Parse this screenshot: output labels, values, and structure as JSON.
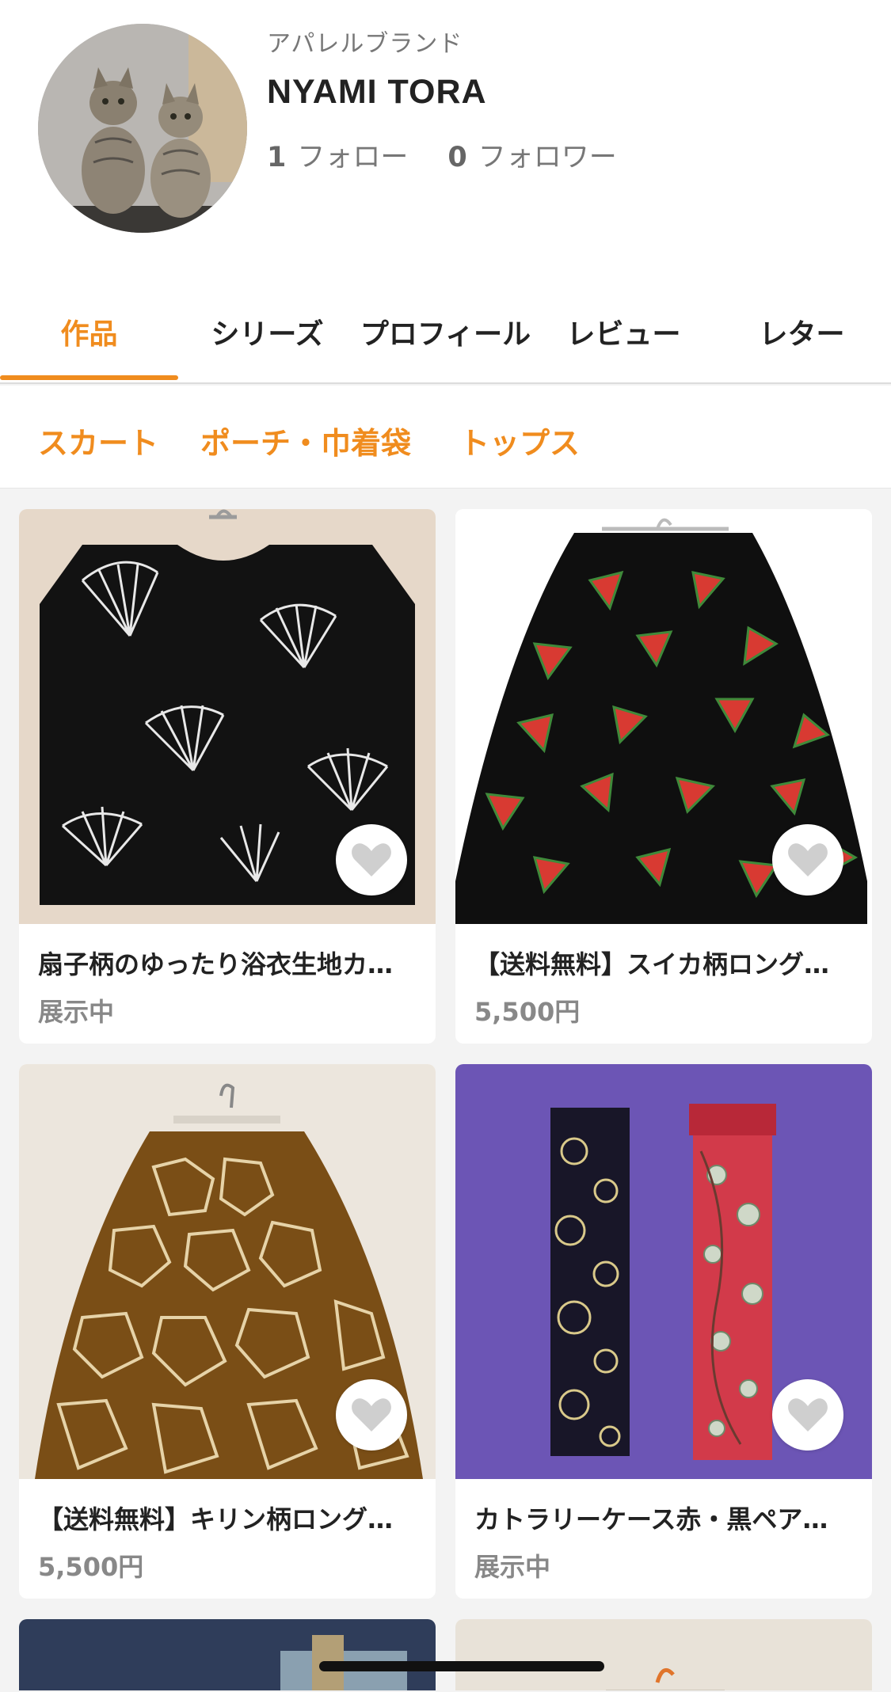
{
  "profile": {
    "category": "アパレルブランド",
    "name": "NYAMI TORA",
    "follow_count": "1",
    "follow_label": "フォロー",
    "follower_count": "0",
    "follower_label": "フォロワー"
  },
  "tabs": [
    {
      "label": "作品",
      "active": true
    },
    {
      "label": "シリーズ",
      "active": false
    },
    {
      "label": "プロフィール",
      "active": false
    },
    {
      "label": "レビュー",
      "active": false
    },
    {
      "label": "レター",
      "active": false
    }
  ],
  "subcategories": [
    "スカート",
    "ポーチ・巾着袋",
    "トップス"
  ],
  "products": [
    {
      "title": "扇子柄のゆったり浴衣生地カ…",
      "price": "展示中"
    },
    {
      "title": "【送料無料】スイカ柄ロング…",
      "price": "5,500円"
    },
    {
      "title": "【送料無料】キリン柄ロング…",
      "price": "5,500円"
    },
    {
      "title": "カトラリーケース赤・黒ペア…",
      "price": "展示中"
    }
  ],
  "colors": {
    "accent": "#f08c1e",
    "background": "#f3f3f3",
    "text": "#222222",
    "muted": "#888888"
  },
  "icons": {
    "favorite": "heart-icon"
  }
}
